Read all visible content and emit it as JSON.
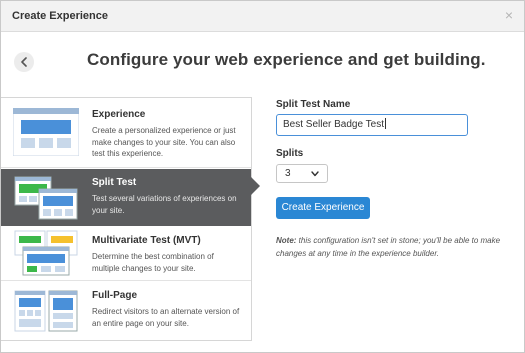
{
  "dialog": {
    "title": "Create Experience",
    "close_glyph": "×"
  },
  "heading": "Configure your web experience and get building.",
  "options": [
    {
      "name": "Experience",
      "desc": "Create a personalized experience or just make changes to your site. You can also test this experience.",
      "icon": "experience-thumbnail-icon",
      "selected": false
    },
    {
      "name": "Split Test",
      "desc": "Test several variations of experiences on your site.",
      "icon": "split-test-thumbnail-icon",
      "selected": true
    },
    {
      "name": "Multivariate Test (MVT)",
      "desc": "Determine the best combination of multiple changes to your site.",
      "icon": "mvt-thumbnail-icon",
      "selected": false
    },
    {
      "name": "Full-Page",
      "desc": "Redirect visitors to an alternate version of an entire page on your site.",
      "icon": "full-page-thumbnail-icon",
      "selected": false
    }
  ],
  "form": {
    "name_label": "Split Test Name",
    "name_value": "Best Seller Badge Test",
    "splits_label": "Splits",
    "splits_value": "3",
    "create_label": "Create Experience",
    "note_prefix": "Note:",
    "note_text": " this configuration isn't set in stone; you'll be able to make changes at any time in the experience builder."
  },
  "colors": {
    "selected_bg": "#5b5c5e",
    "accent_blue": "#2a87d4",
    "input_focus": "#4a90d9",
    "thumb_blue": "#4a90d9",
    "thumb_green": "#3cb84a",
    "thumb_yellow": "#f5c12e"
  }
}
